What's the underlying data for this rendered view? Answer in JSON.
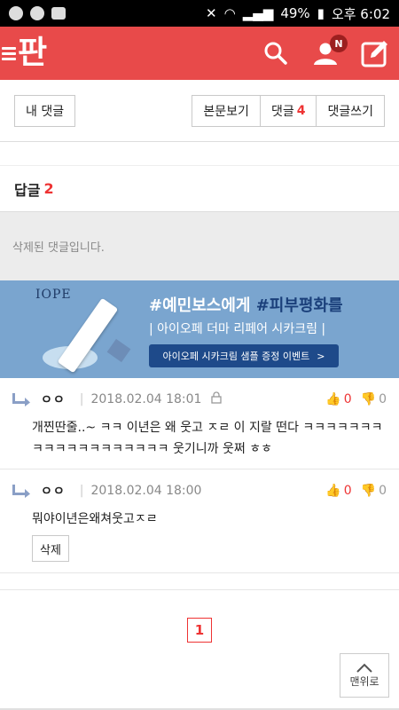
{
  "status_bar": {
    "battery": "49%",
    "time": "오후 6:02"
  },
  "header": {
    "logo": "판",
    "notification_badge": "N"
  },
  "topbar": {
    "my_comments": "내 댓글",
    "view_post": "본문보기",
    "comments_label": "댓글",
    "comments_count": "4",
    "write_comment": "댓글쓰기"
  },
  "replies": {
    "label": "답글",
    "count": "2"
  },
  "deleted_notice": "삭제된 댓글입니다.",
  "ad": {
    "brand": "IOPE",
    "line1_a": "#예민보스에게 ",
    "line1_b": "#피부평화를",
    "line2": "| 아이오페 더마 리페어 시카크림 |",
    "cta": "아이오페 시카크림 샘플 증정 이벤트",
    "cta_arrow": ">"
  },
  "comments": [
    {
      "author": "ㅇㅇ",
      "date": "2018.02.04 18:01",
      "up": "0",
      "down": "0",
      "body": "개찐딴줄..~ ㅋㅋ 이년은 왜 웃고 ㅈㄹ 이 지랄 떤다 ㅋㅋㅋㅋㅋㅋㅋ ㅋㅋㅋㅋㅋㅋㅋㅋㅋㅋㅋㅋ 웃기니까 웃쩌 ㅎㅎ"
    },
    {
      "author": "ㅇㅇ",
      "date": "2018.02.04 18:00",
      "up": "0",
      "down": "0",
      "body": "뭐야이년은왜쳐웃고ㅈㄹ",
      "delete_label": "삭제"
    }
  ],
  "pager": {
    "current": "1"
  },
  "scroll_top": {
    "label": "맨위로"
  },
  "colors": {
    "brand_red": "#e84a4a",
    "accent_red": "#e33"
  }
}
